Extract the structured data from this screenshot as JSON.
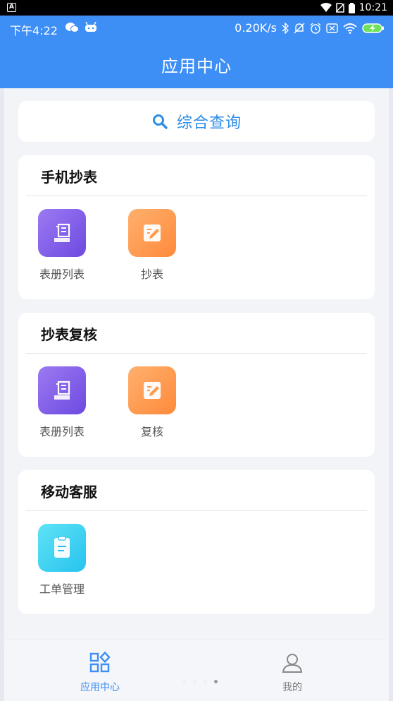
{
  "system_bar": {
    "time": "10:21"
  },
  "status_row": {
    "time": "下午4:22",
    "speed": "0.20K/s"
  },
  "header": {
    "title": "应用中心"
  },
  "search": {
    "label": "综合查询",
    "icon": "search-icon"
  },
  "sections": [
    {
      "title": "手机抄表",
      "apps": [
        {
          "name": "表册列表",
          "icon": "book-list-icon",
          "color": "#7b57e8"
        },
        {
          "name": "抄表",
          "icon": "edit-note-icon",
          "color": "#ff9a4c"
        }
      ]
    },
    {
      "title": "抄表复核",
      "apps": [
        {
          "name": "表册列表",
          "icon": "book-list-icon",
          "color": "#7b57e8"
        },
        {
          "name": "复核",
          "icon": "edit-note-icon",
          "color": "#ff9a4c"
        }
      ]
    },
    {
      "title": "移动客服",
      "apps": [
        {
          "name": "工单管理",
          "icon": "work-order-icon",
          "color": "#3acdf1"
        }
      ]
    }
  ],
  "tabbar": {
    "items": [
      {
        "label": "应用中心",
        "icon": "grid-apps-icon",
        "active": true
      },
      {
        "label": "我的",
        "icon": "user-icon",
        "active": false
      }
    ],
    "accent": "#3d8ef5"
  }
}
